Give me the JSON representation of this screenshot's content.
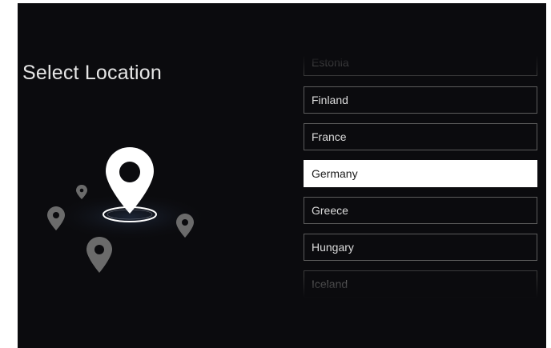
{
  "screen": {
    "title": "Select Location"
  },
  "illustration": {
    "icon": "location-pin-icon",
    "pin_color": "#ffffff",
    "secondary_pin_color": "#6b6b6b"
  },
  "location_list": {
    "items": [
      {
        "label": "Estonia",
        "state": "faded"
      },
      {
        "label": "Finland",
        "state": "normal"
      },
      {
        "label": "France",
        "state": "normal"
      },
      {
        "label": "Germany",
        "state": "selected"
      },
      {
        "label": "Greece",
        "state": "normal"
      },
      {
        "label": "Hungary",
        "state": "normal"
      },
      {
        "label": "Iceland",
        "state": "faded"
      }
    ],
    "selected_color": "#ffffff"
  }
}
